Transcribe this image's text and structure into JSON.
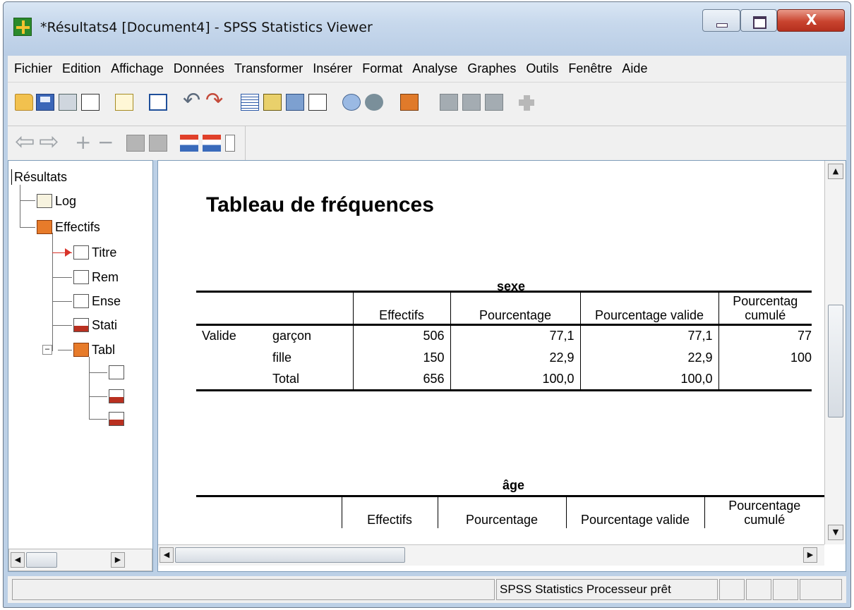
{
  "window": {
    "title": "*Résultats4 [Document4] - SPSS Statistics Viewer",
    "close_glyph": "X"
  },
  "menu": [
    "Fichier",
    "Edition",
    "Affichage",
    "Données",
    "Transformer",
    "Insérer",
    "Format",
    "Analyse",
    "Graphes",
    "Outils",
    "Fenêtre",
    "Aide"
  ],
  "toolbar_icons": [
    "open-icon",
    "save-icon",
    "print-icon",
    "print-preview-icon",
    "export-icon",
    "recall-dialog-icon",
    "undo-icon",
    "redo-icon",
    "go-to-data-icon",
    "go-to-case-icon",
    "go-to-variable-icon",
    "variables-icon",
    "use-sets-icon",
    "show-all-variables-icon",
    "split-file-icon",
    "select-cases-icon",
    "weight-cases-icon",
    "value-labels-icon",
    "designate-window-icon"
  ],
  "outline": {
    "root": "Résultats",
    "items": [
      {
        "label": "Log",
        "icon": "log-icon"
      },
      {
        "label": "Effectifs",
        "icon": "procedure-icon"
      },
      {
        "label": "Titre",
        "icon": "title-icon"
      },
      {
        "label": "Rem",
        "icon": "notes-icon"
      },
      {
        "label": "Ense",
        "icon": "dataset-icon"
      },
      {
        "label": "Stati",
        "icon": "table-icon"
      },
      {
        "label": "Tabl",
        "icon": "procedure-icon"
      }
    ]
  },
  "content": {
    "title": "Tableau de fréquences",
    "tables": [
      {
        "caption": "sexe",
        "columns": [
          "Effectifs",
          "Pourcentage",
          "Pourcentage valide",
          "Pourcentag cumulé"
        ],
        "row_group": "Valide",
        "rows": [
          {
            "label": "garçon",
            "effectifs": "506",
            "pourcentage": "77,1",
            "valide": "77,1",
            "cumule": "77"
          },
          {
            "label": "fille",
            "effectifs": "150",
            "pourcentage": "22,9",
            "valide": "22,9",
            "cumule": "100"
          },
          {
            "label": "Total",
            "effectifs": "656",
            "pourcentage": "100,0",
            "valide": "100,0",
            "cumule": ""
          }
        ]
      },
      {
        "caption": "âge",
        "columns": [
          "Effectifs",
          "Pourcentage",
          "Pourcentage valide",
          "Pourcentage cumulé"
        ]
      }
    ]
  },
  "status": {
    "processor": "SPSS Statistics  Processeur prêt"
  }
}
